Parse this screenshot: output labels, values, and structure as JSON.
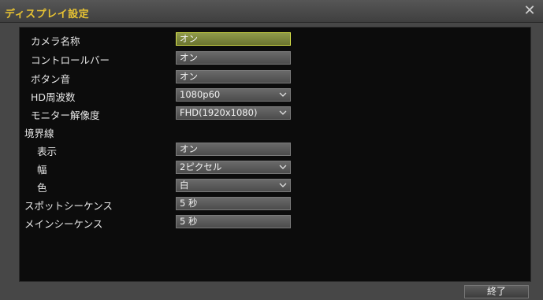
{
  "window": {
    "title": "ディスプレイ設定",
    "close_glyph": "✕"
  },
  "settings": {
    "camera_name": {
      "label": "カメラ名称",
      "value": "オン"
    },
    "control_bar": {
      "label": "コントロールバー",
      "value": "オン"
    },
    "button_sound": {
      "label": "ボタン音",
      "value": "オン"
    },
    "hd_frequency": {
      "label": "HD周波数",
      "value": "1080p60"
    },
    "monitor_resolution": {
      "label": "モニター解像度",
      "value": "FHD(1920x1080)"
    },
    "border_heading": {
      "label": "境界線"
    },
    "border_display": {
      "label": "表示",
      "value": "オン"
    },
    "border_width": {
      "label": "幅",
      "value": "2ピクセル"
    },
    "border_color": {
      "label": "色",
      "value": "白"
    },
    "spot_sequence": {
      "label": "スポットシーケンス",
      "value": "5 秒"
    },
    "main_sequence": {
      "label": "メインシーケンス",
      "value": "5 秒"
    }
  },
  "footer": {
    "exit_label": "終了"
  },
  "colors": {
    "title": "#e8c332",
    "selected_border": "#d7e14a"
  }
}
